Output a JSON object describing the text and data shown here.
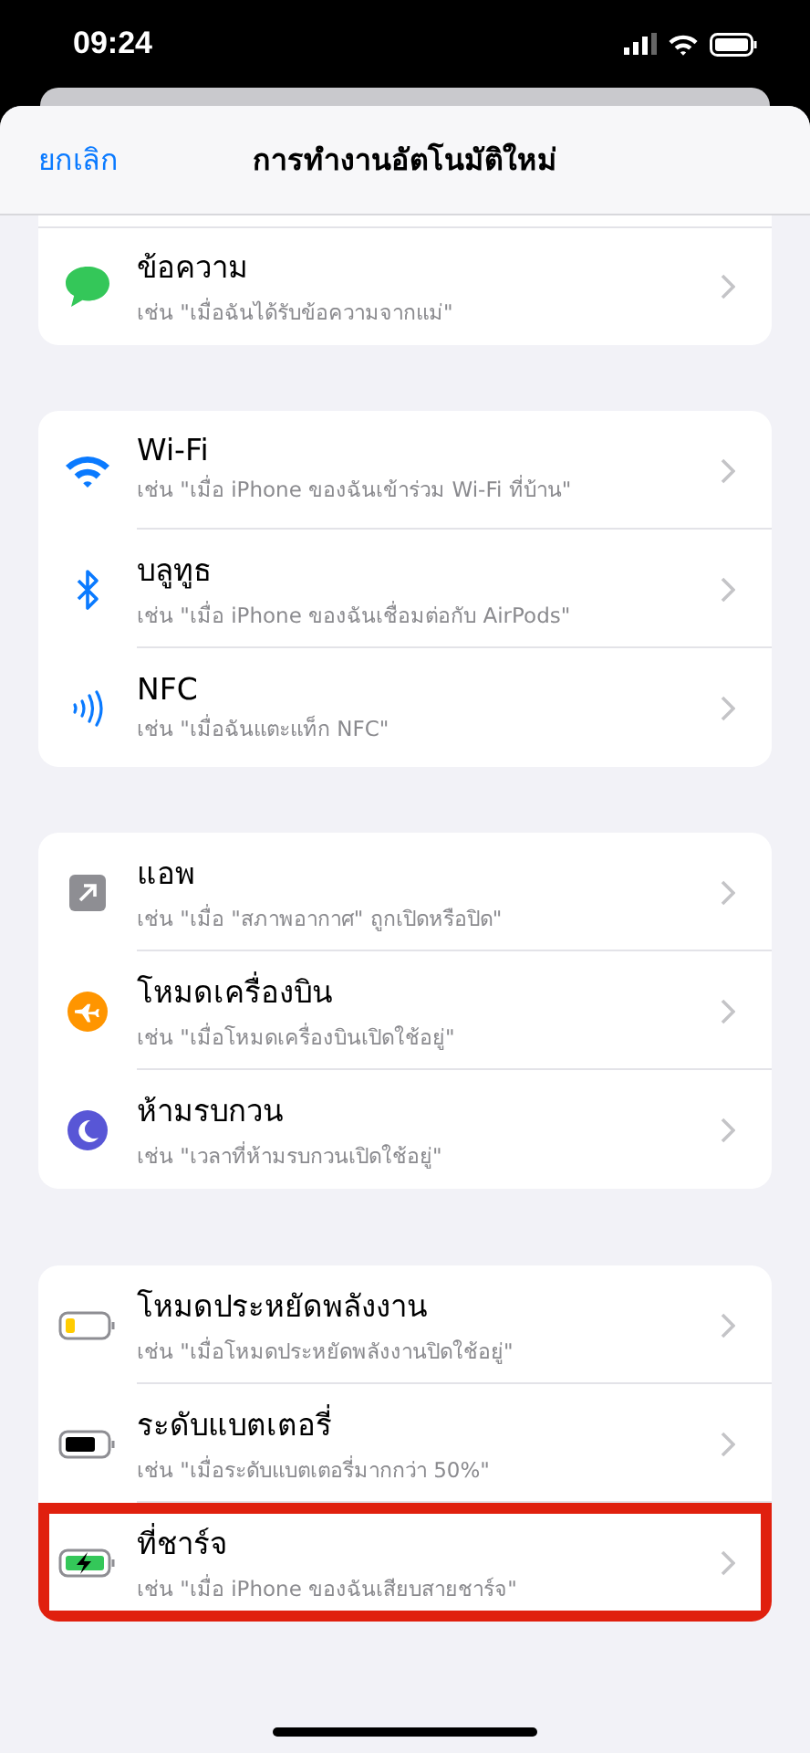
{
  "status_bar": {
    "time": "09:24"
  },
  "header": {
    "cancel": "ยกเลิก",
    "title": "การทำงานอัตโนมัติใหม่"
  },
  "groups": [
    {
      "items": [
        {
          "kind": "message",
          "title": "ข้อความ",
          "subtitle": "เช่น \"เมื่อฉันได้รับข้อความจากแม่\"",
          "highlighted": false
        }
      ]
    },
    {
      "items": [
        {
          "kind": "wifi",
          "title": "Wi-Fi",
          "subtitle": "เช่น \"เมื่อ iPhone ของฉันเข้าร่วม Wi-Fi ที่บ้าน\"",
          "highlighted": false
        },
        {
          "kind": "bluetooth",
          "title": "บลูทูธ",
          "subtitle": "เช่น \"เมื่อ iPhone ของฉันเชื่อมต่อกับ AirPods\"",
          "highlighted": false
        },
        {
          "kind": "nfc",
          "title": "NFC",
          "subtitle": "เช่น \"เมื่อฉันแตะแท็ก NFC\"",
          "highlighted": false
        }
      ]
    },
    {
      "items": [
        {
          "kind": "app",
          "title": "แอพ",
          "subtitle": "เช่น \"เมื่อ \"สภาพอากาศ\" ถูกเปิดหรือปิด\"",
          "highlighted": false
        },
        {
          "kind": "airplane",
          "title": "โหมดเครื่องบิน",
          "subtitle": "เช่น \"เมื่อโหมดเครื่องบินเปิดใช้อยู่\"",
          "highlighted": false
        },
        {
          "kind": "moon",
          "title": "ห้ามรบกวน",
          "subtitle": "เช่น \"เวลาที่ห้ามรบกวนเปิดใช้อยู่\"",
          "highlighted": false
        }
      ]
    },
    {
      "items": [
        {
          "kind": "low-power",
          "title": "โหมดประหยัดพลังงาน",
          "subtitle": "เช่น \"เมื่อโหมดประหยัดพลังงานปิดใช้อยู่\"",
          "highlighted": false
        },
        {
          "kind": "battery",
          "title": "ระดับแบตเตอรี่",
          "subtitle": "เช่น \"เมื่อระดับแบตเตอรี่มากกว่า 50%\"",
          "highlighted": false
        },
        {
          "kind": "charger",
          "title": "ที่ชาร์จ",
          "subtitle": "เช่น \"เมื่อ iPhone ของฉันเสียบสายชาร์จ\"",
          "highlighted": true
        }
      ]
    }
  ]
}
